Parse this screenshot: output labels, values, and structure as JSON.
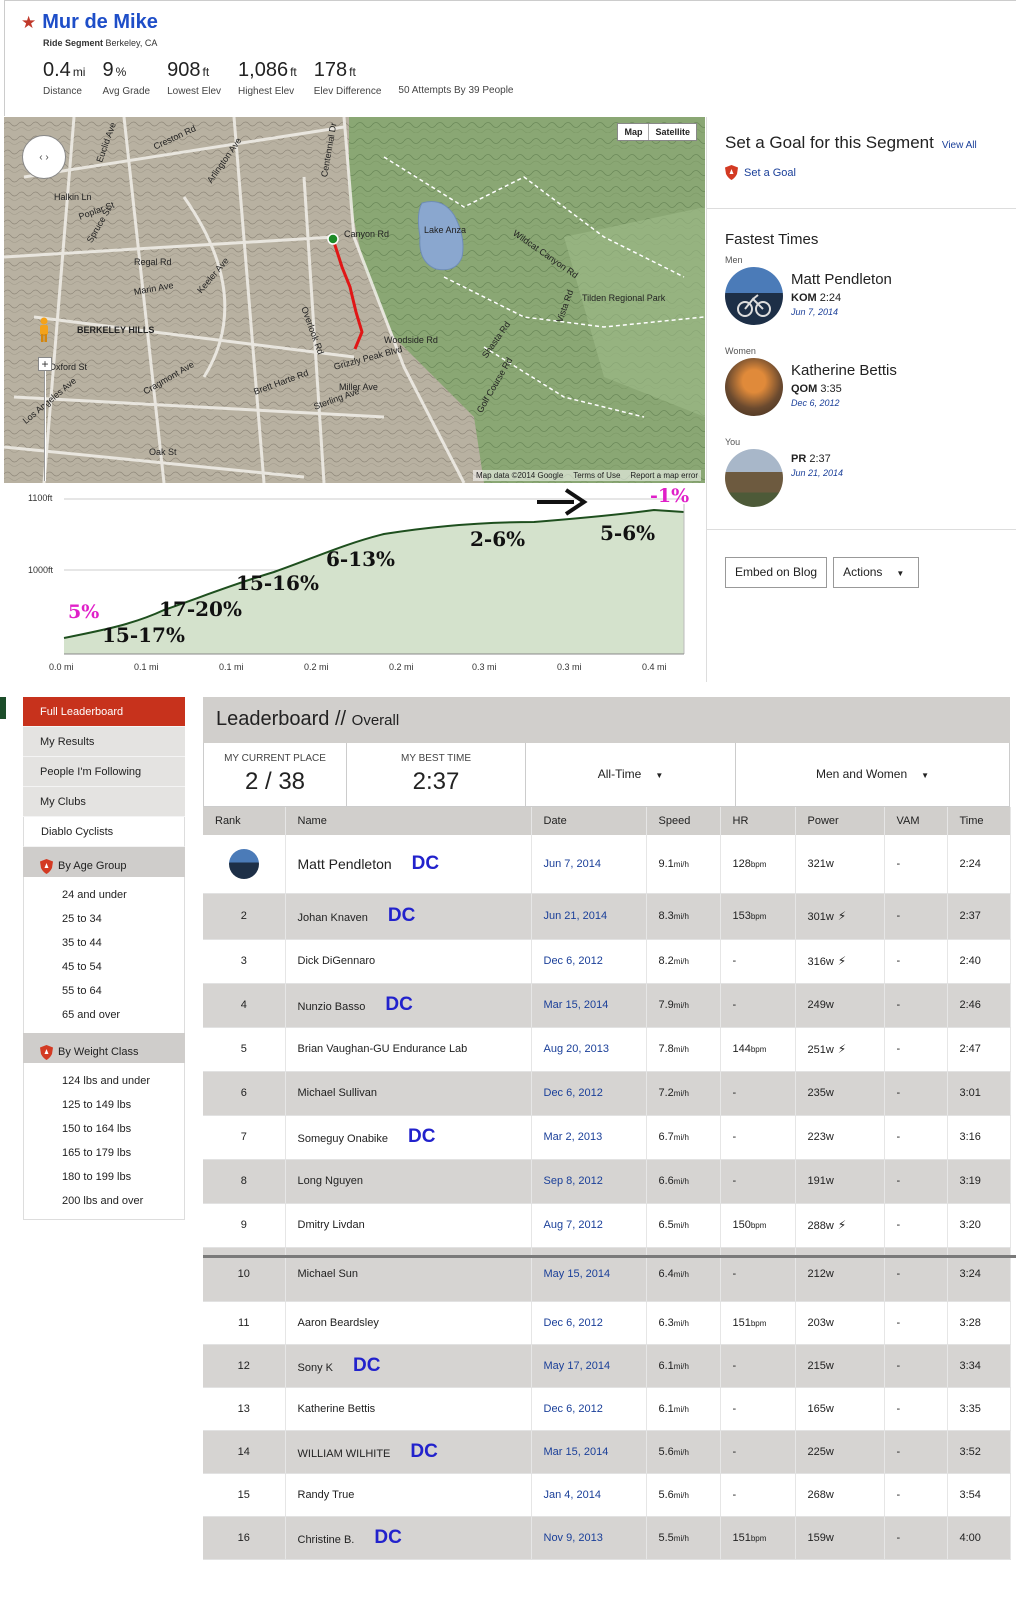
{
  "segment": {
    "title": "Mur de Mike",
    "type_label": "Ride Segment",
    "location": "Berkeley, CA",
    "stats": [
      {
        "value": "0.4",
        "unit": "mi",
        "label": "Distance"
      },
      {
        "value": "9",
        "unit": "%",
        "label": "Avg Grade"
      },
      {
        "value": "908",
        "unit": "ft",
        "label": "Lowest Elev"
      },
      {
        "value": "1,086",
        "unit": "ft",
        "label": "Highest Elev"
      },
      {
        "value": "178",
        "unit": "ft",
        "label": "Elev Difference"
      }
    ],
    "attempts": "50 Attempts By 39 People"
  },
  "map": {
    "type_map": "Map",
    "type_satellite": "Satellite",
    "footer_data": "Map data ©2014 Google",
    "footer_terms": "Terms of Use",
    "footer_report": "Report a map error",
    "labels": [
      "Creston Rd",
      "Euclid Ave",
      "Halkin Ln",
      "Poplar St",
      "Woodside Rd",
      "Canyon Rd",
      "Lake Anza",
      "Wildcat Canyon Rd",
      "Tilden Regional Park",
      "BERKELEY HILLS",
      "Grizzly Peak Blvd",
      "Marin Ave",
      "Los Angeles Ave",
      "Oxford St",
      "Shasta Rd",
      "Golf Course Rd",
      "Spruce St",
      "Regal Rd",
      "Keeler Ave",
      "Miller Ave",
      "Sterling Ave",
      "Oak St",
      "Overlook Rd",
      "Centennial Dr",
      "Vista Rd",
      "Arlington Ave",
      "Cragmont Ave",
      "Brett Harte Rd"
    ]
  },
  "elevation": {
    "y_labels": [
      "1100ft",
      "1000ft"
    ],
    "x_labels": [
      "0.0 mi",
      "0.1 mi",
      "0.1 mi",
      "0.2 mi",
      "0.2 mi",
      "0.3 mi",
      "0.3 mi",
      "0.4 mi"
    ],
    "annotations": [
      "5%",
      "15-17%",
      "17-20%",
      "15-16%",
      "6-13%",
      "2-6%",
      "5-6%",
      "-1%"
    ]
  },
  "goal": {
    "title": "Set a Goal for this Segment",
    "view_all": "View All",
    "set_goal": "Set a Goal"
  },
  "fastest": {
    "title": "Fastest Times",
    "men": {
      "category": "Men",
      "name": "Matt Pendleton",
      "badge": "KOM",
      "time": "2:24",
      "date": "Jun 7, 2014"
    },
    "women": {
      "category": "Women",
      "name": "Katherine Bettis",
      "badge": "QOM",
      "time": "3:35",
      "date": "Dec 6, 2012"
    },
    "you": {
      "category": "You",
      "badge": "PR",
      "time": "2:37",
      "date": "Jun 21, 2014"
    }
  },
  "actions": {
    "embed": "Embed on Blog",
    "actions": "Actions"
  },
  "sidebar": {
    "items": [
      "Full Leaderboard",
      "My Results",
      "People I'm Following",
      "My Clubs",
      "Diablo Cyclists"
    ],
    "age_group": {
      "label": "By Age Group",
      "items": [
        "24 and under",
        "25 to 34",
        "35 to 44",
        "45 to 54",
        "55 to 64",
        "65 and over"
      ]
    },
    "weight_class": {
      "label": "By Weight Class",
      "items": [
        "124 lbs and under",
        "125 to 149 lbs",
        "150 to 164 lbs",
        "165 to 179 lbs",
        "180 to 199 lbs",
        "200 lbs and over"
      ]
    }
  },
  "leaderboard": {
    "title": "Leaderboard //",
    "subtitle": "Overall",
    "current_place_label": "MY CURRENT PLACE",
    "current_place": "2 / 38",
    "best_time_label": "MY BEST TIME",
    "best_time": "2:37",
    "filter_time": "All-Time",
    "filter_gender": "Men and Women",
    "columns": [
      "Rank",
      "Name",
      "Date",
      "Speed",
      "HR",
      "Power",
      "VAM",
      "Time"
    ],
    "rows": [
      {
        "rank": "",
        "name": "Matt Pendleton",
        "dc": "DC",
        "date": "Jun 7, 2014",
        "speed": "9.1",
        "hr": "128",
        "power": "321w",
        "bolt": false,
        "vam": "-",
        "time": "2:24"
      },
      {
        "rank": "2",
        "name": "Johan Knaven",
        "dc": "DC",
        "date": "Jun 21, 2014",
        "speed": "8.3",
        "hr": "153",
        "power": "301w",
        "bolt": true,
        "vam": "-",
        "time": "2:37"
      },
      {
        "rank": "3",
        "name": "Dick DiGennaro",
        "dc": "",
        "date": "Dec 6, 2012",
        "speed": "8.2",
        "hr": "-",
        "power": "316w",
        "bolt": true,
        "vam": "-",
        "time": "2:40"
      },
      {
        "rank": "4",
        "name": "Nunzio Basso",
        "dc": "DC",
        "date": "Mar 15, 2014",
        "speed": "7.9",
        "hr": "-",
        "power": "249w",
        "bolt": false,
        "vam": "-",
        "time": "2:46"
      },
      {
        "rank": "5",
        "name": "Brian Vaughan-GU Endurance Lab",
        "dc": "",
        "date": "Aug 20, 2013",
        "speed": "7.8",
        "hr": "144",
        "power": "251w",
        "bolt": true,
        "vam": "-",
        "time": "2:47"
      },
      {
        "rank": "6",
        "name": "Michael Sullivan",
        "dc": "",
        "date": "Dec 6, 2012",
        "speed": "7.2",
        "hr": "-",
        "power": "235w",
        "bolt": false,
        "vam": "-",
        "time": "3:01"
      },
      {
        "rank": "7",
        "name": "Someguy Onabike",
        "dc": "DC",
        "date": "Mar 2, 2013",
        "speed": "6.7",
        "hr": "-",
        "power": "223w",
        "bolt": false,
        "vam": "-",
        "time": "3:16"
      },
      {
        "rank": "8",
        "name": "Long Nguyen",
        "dc": "",
        "date": "Sep 8, 2012",
        "speed": "6.6",
        "hr": "-",
        "power": "191w",
        "bolt": false,
        "vam": "-",
        "time": "3:19"
      },
      {
        "rank": "9",
        "name": "Dmitry Livdan",
        "dc": "",
        "date": "Aug 7, 2012",
        "speed": "6.5",
        "hr": "150",
        "power": "288w",
        "bolt": true,
        "vam": "-",
        "time": "3:20"
      },
      {
        "rank": "10",
        "name": "Michael Sun",
        "dc": "",
        "date": "May 15, 2014",
        "speed": "6.4",
        "hr": "-",
        "power": "212w",
        "bolt": false,
        "vam": "-",
        "time": "3:24"
      },
      {
        "rank": "11",
        "name": "Aaron Beardsley",
        "dc": "",
        "date": "Dec 6, 2012",
        "speed": "6.3",
        "hr": "151",
        "power": "203w",
        "bolt": false,
        "vam": "-",
        "time": "3:28"
      },
      {
        "rank": "12",
        "name": "Sony K",
        "dc": "DC",
        "date": "May 17, 2014",
        "speed": "6.1",
        "hr": "-",
        "power": "215w",
        "bolt": false,
        "vam": "-",
        "time": "3:34"
      },
      {
        "rank": "13",
        "name": "Katherine Bettis",
        "dc": "",
        "date": "Dec 6, 2012",
        "speed": "6.1",
        "hr": "-",
        "power": "165w",
        "bolt": false,
        "vam": "-",
        "time": "3:35"
      },
      {
        "rank": "14",
        "name": "WILLIAM WILHITE",
        "dc": "DC",
        "date": "Mar 15, 2014",
        "speed": "5.6",
        "hr": "-",
        "power": "225w",
        "bolt": false,
        "vam": "-",
        "time": "3:52"
      },
      {
        "rank": "15",
        "name": "Randy True",
        "dc": "",
        "date": "Jan 4, 2014",
        "speed": "5.6",
        "hr": "-",
        "power": "268w",
        "bolt": false,
        "vam": "-",
        "time": "3:54"
      },
      {
        "rank": "16",
        "name": "Christine B.",
        "dc": "DC",
        "date": "Nov 9, 2013",
        "speed": "5.5",
        "hr": "151",
        "power": "159w",
        "bolt": false,
        "vam": "-",
        "time": "4:00"
      }
    ],
    "speed_unit": "mi/h",
    "hr_unit": "bpm"
  }
}
